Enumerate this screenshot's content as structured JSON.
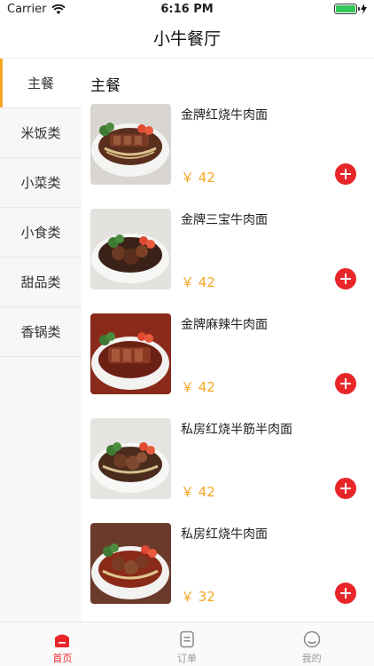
{
  "status_bar": {
    "carrier": "Carrier",
    "time": "6:16 PM"
  },
  "nav": {
    "title": "小牛餐厅"
  },
  "sidebar": {
    "items": [
      {
        "label": "主餐",
        "active": true
      },
      {
        "label": "米饭类"
      },
      {
        "label": "小菜类"
      },
      {
        "label": "小食类"
      },
      {
        "label": "甜品类"
      },
      {
        "label": "香锅类"
      }
    ]
  },
  "main": {
    "section_title": "主餐",
    "dishes": [
      {
        "name": "金牌红烧牛肉面",
        "price": "￥ 42"
      },
      {
        "name": "金牌三宝牛肉面",
        "price": "￥ 42"
      },
      {
        "name": "金牌麻辣牛肉面",
        "price": "￥ 42"
      },
      {
        "name": "私房红烧半筋半肉面",
        "price": "￥ 42"
      },
      {
        "name": "私房红烧牛肉面",
        "price": "￥ 32"
      }
    ]
  },
  "tab_bar": {
    "tabs": [
      {
        "label": "首页",
        "icon": "home-icon",
        "active": true
      },
      {
        "label": "订单",
        "icon": "order-icon"
      },
      {
        "label": "我的",
        "icon": "profile-icon"
      }
    ]
  },
  "colors": {
    "accent": "#e8262a",
    "price": "#f5a623",
    "sidebar_bg": "#f7f7f7"
  }
}
